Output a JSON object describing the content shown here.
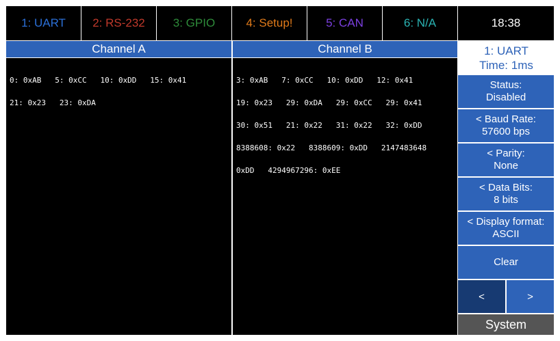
{
  "tabs": [
    {
      "label": "1: UART",
      "color": "#2b6fd6"
    },
    {
      "label": "2: RS-232",
      "color": "#c0392b"
    },
    {
      "label": "3: GPIO",
      "color": "#2e8b3a"
    },
    {
      "label": "4: Setup!",
      "color": "#e07a1a"
    },
    {
      "label": "5: CAN",
      "color": "#7b3fe0"
    },
    {
      "label": "6: N/A",
      "color": "#2ab3b3"
    }
  ],
  "clock": "18:38",
  "channel_a": {
    "title": "Channel A",
    "lines": [
      "0: 0xAB   5: 0xCC   10: 0xDD   15: 0x41",
      "21: 0x23   23: 0xDA"
    ]
  },
  "channel_b": {
    "title": "Channel B",
    "lines": [
      "3: 0xAB   7: 0xCC   10: 0xDD   12: 0x41",
      "19: 0x23   29: 0xDA   29: 0xCC   29: 0x41",
      "30: 0x51   21: 0x22   31: 0x22   32: 0xDD",
      "8388608: 0x22   8388609: 0xDD   2147483648",
      "0xDD   4294967296: 0xEE"
    ]
  },
  "info": {
    "line1": "1: UART",
    "line2": "Time: 1ms"
  },
  "settings": [
    {
      "label": "Status:",
      "value": "Disabled"
    },
    {
      "label": "< Baud Rate:",
      "value": "57600 bps"
    },
    {
      "label": "< Parity:",
      "value": "None"
    },
    {
      "label": "< Data Bits:",
      "value": "8 bits"
    },
    {
      "label": "< Display format:",
      "value": "ASCII"
    }
  ],
  "clear_label": "Clear",
  "nav": {
    "prev": "<",
    "next": ">"
  },
  "system_label": "System"
}
